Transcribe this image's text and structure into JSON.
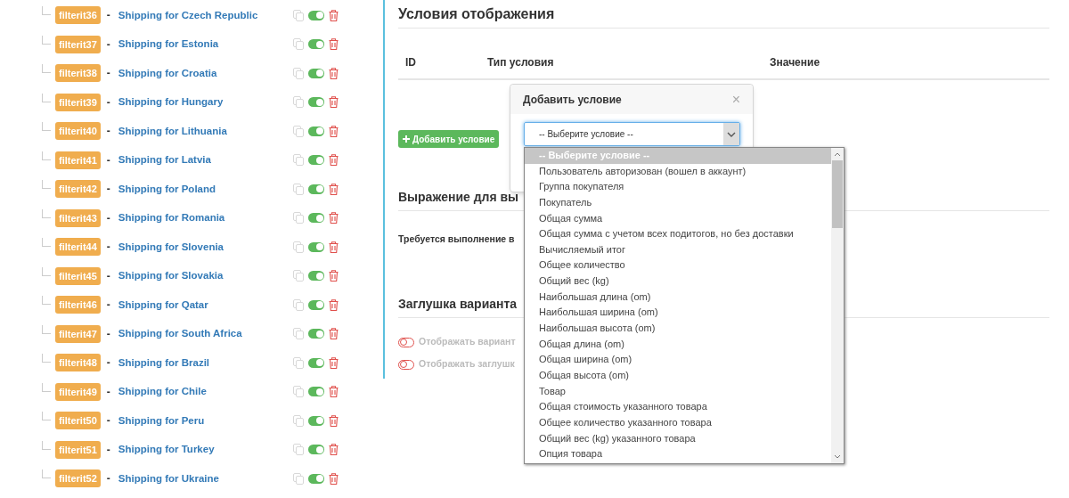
{
  "filters": [
    {
      "badge": "filterit36",
      "name": "Shipping for Czech Republic",
      "enabled": true
    },
    {
      "badge": "filterit37",
      "name": "Shipping for Estonia",
      "enabled": true
    },
    {
      "badge": "filterit38",
      "name": "Shipping for Croatia",
      "enabled": true
    },
    {
      "badge": "filterit39",
      "name": "Shipping for Hungary",
      "enabled": true
    },
    {
      "badge": "filterit40",
      "name": "Shipping for Lithuania",
      "enabled": true
    },
    {
      "badge": "filterit41",
      "name": "Shipping for Latvia",
      "enabled": true
    },
    {
      "badge": "filterit42",
      "name": "Shipping for Poland",
      "enabled": true
    },
    {
      "badge": "filterit43",
      "name": "Shipping for Romania",
      "enabled": true
    },
    {
      "badge": "filterit44",
      "name": "Shipping for Slovenia",
      "enabled": true
    },
    {
      "badge": "filterit45",
      "name": "Shipping for Slovakia",
      "enabled": true
    },
    {
      "badge": "filterit46",
      "name": "Shipping for Qatar",
      "enabled": true
    },
    {
      "badge": "filterit47",
      "name": "Shipping for South Africa",
      "enabled": true
    },
    {
      "badge": "filterit48",
      "name": "Shipping for Brazil",
      "enabled": true
    },
    {
      "badge": "filterit49",
      "name": "Shipping for Chile",
      "enabled": true
    },
    {
      "badge": "filterit50",
      "name": "Shipping for Peru",
      "enabled": true
    },
    {
      "badge": "filterit51",
      "name": "Shipping for Turkey",
      "enabled": true
    },
    {
      "badge": "filterit52",
      "name": "Shipping for Ukraine",
      "enabled": true
    }
  ],
  "conditions": {
    "title": "Условия отображения",
    "columns": [
      "ID",
      "Тип условия",
      "Значение"
    ],
    "add_button": "Добавить условие"
  },
  "popover": {
    "title": "Добавить условие",
    "close": "×",
    "select": {
      "value": "-- Выберите условие --"
    },
    "options": [
      {
        "label": "-- Выберите условие --",
        "selected": true
      },
      {
        "label": "Пользователь авторизован (вошел в аккаунт)",
        "selected": false
      },
      {
        "label": "Группа покупателя",
        "selected": false
      },
      {
        "label": "Покупатель",
        "selected": false
      },
      {
        "label": "Общая сумма",
        "selected": false
      },
      {
        "label": "Общая сумма с учетом всех подитогов, но без доставки",
        "selected": false
      },
      {
        "label": "Вычисляемый итог",
        "selected": false
      },
      {
        "label": "Общее количество",
        "selected": false
      },
      {
        "label": "Общий вес (kg)",
        "selected": false
      },
      {
        "label": "Наибольшая длина (om)",
        "selected": false
      },
      {
        "label": "Наибольшая ширина (om)",
        "selected": false
      },
      {
        "label": "Наибольшая высота (om)",
        "selected": false
      },
      {
        "label": "Общая длина (om)",
        "selected": false
      },
      {
        "label": "Общая ширина (om)",
        "selected": false
      },
      {
        "label": "Общая высота (om)",
        "selected": false
      },
      {
        "label": "Товар",
        "selected": false
      },
      {
        "label": "Общая стоимость указанного товара",
        "selected": false
      },
      {
        "label": "Общее количество указанного товара",
        "selected": false
      },
      {
        "label": "Общий вес (kg) указанного товара",
        "selected": false
      },
      {
        "label": "Опция товара",
        "selected": false
      }
    ]
  },
  "separator": "-",
  "expression": {
    "title": "Выражение для вы",
    "text": "Требуется выполнение в"
  },
  "stub": {
    "title": "Заглушка варианта",
    "options": [
      {
        "label": "Отображать вариант",
        "on": false
      },
      {
        "label": "Отображать заглушк",
        "on": false
      }
    ]
  }
}
